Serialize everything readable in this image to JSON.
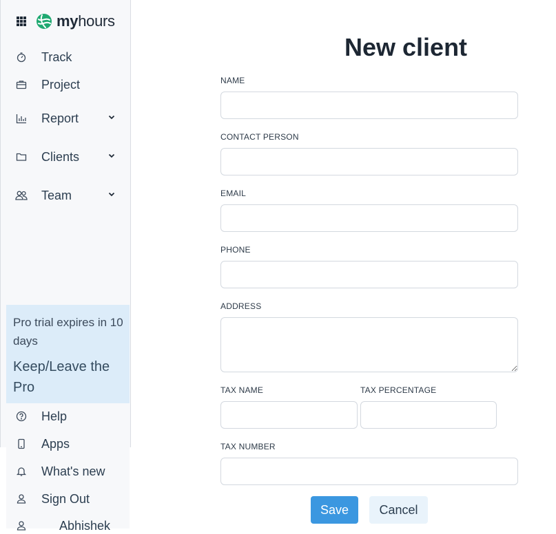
{
  "brand": {
    "bold": "my",
    "regular": "hours"
  },
  "nav": {
    "track": "Track",
    "project": "Project",
    "report": "Report",
    "clients": "Clients",
    "team": "Team",
    "help": "Help",
    "apps": "Apps",
    "whats_new": "What's new",
    "sign_out": "Sign Out",
    "user": "Abhishek"
  },
  "trial": {
    "message": "Pro trial expires in 10 days",
    "link": "Keep/Leave the Pro"
  },
  "form": {
    "title": "New client",
    "name_label": "NAME",
    "contact_label": "CONTACT PERSON",
    "email_label": "EMAIL",
    "phone_label": "PHONE",
    "address_label": "ADDRESS",
    "tax_name_label": "TAX NAME",
    "tax_percentage_label": "TAX PERCENTAGE",
    "tax_number_label": "TAX NUMBER",
    "name_value": "",
    "contact_value": "",
    "email_value": "",
    "phone_value": "",
    "address_value": "",
    "tax_name_value": "",
    "tax_percentage_value": "",
    "tax_number_value": ""
  },
  "actions": {
    "save": "Save",
    "cancel": "Cancel"
  },
  "colors": {
    "primary": "#3b97e0",
    "brand_green": "#1fa971",
    "trial_bg": "#dcecf9"
  },
  "icons": {
    "menu": "apps-grid-icon",
    "logo": "myhours-logo-icon",
    "track": "stopwatch-icon",
    "project": "briefcase-icon",
    "report": "bar-chart-icon",
    "clients": "folder-icon",
    "team": "users-icon",
    "help": "help-circle-icon",
    "apps": "smartphone-icon",
    "whats_new": "bell-icon",
    "sign_out": "user-icon",
    "chevron": "chevron-down-icon"
  }
}
